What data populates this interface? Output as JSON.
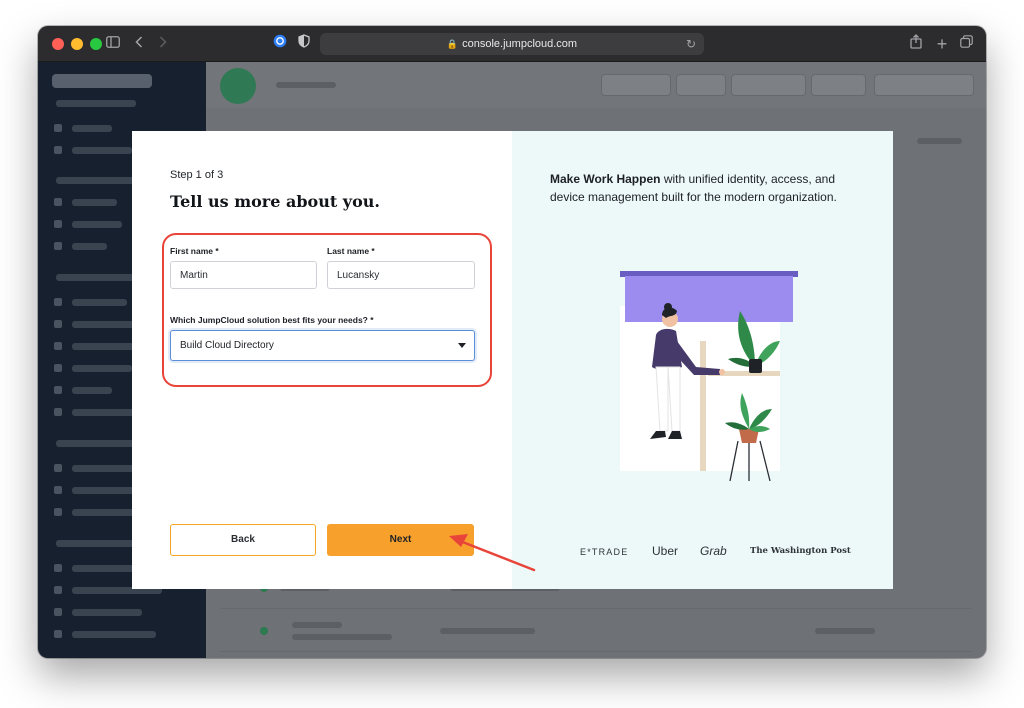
{
  "browser": {
    "url": "console.jumpcloud.com"
  },
  "modal": {
    "step": "Step 1 of 3",
    "heading": "Tell us more about you.",
    "first_name": {
      "label": "First name *",
      "value": "Martin"
    },
    "last_name": {
      "label": "Last name *",
      "value": "Lucansky"
    },
    "solution": {
      "label": "Which JumpCloud solution best fits your needs? *",
      "value": "Build Cloud Directory"
    },
    "back_label": "Back",
    "next_label": "Next",
    "promo_bold": "Make Work Happen",
    "promo_rest": " with unified identity, access, and device management built for the modern organization.",
    "logos": {
      "etrade": "E*TRADE",
      "uber": "Uber",
      "grab": "Grab",
      "wapo": "The Washington Post"
    }
  },
  "colors": {
    "accent": "#f8a02c",
    "highlight": "#e8443a",
    "panel": "#edf8f9",
    "illustration_purple": "#9c8cf0"
  },
  "icons": [
    "sidebar-toggle-icon",
    "back-icon",
    "forward-icon",
    "password-manager-icon",
    "privacy-shield-icon",
    "lock-icon",
    "reload-icon",
    "share-icon",
    "new-tab-icon",
    "tabs-overview-icon",
    "chevron-down-icon",
    "annotation-arrow"
  ]
}
